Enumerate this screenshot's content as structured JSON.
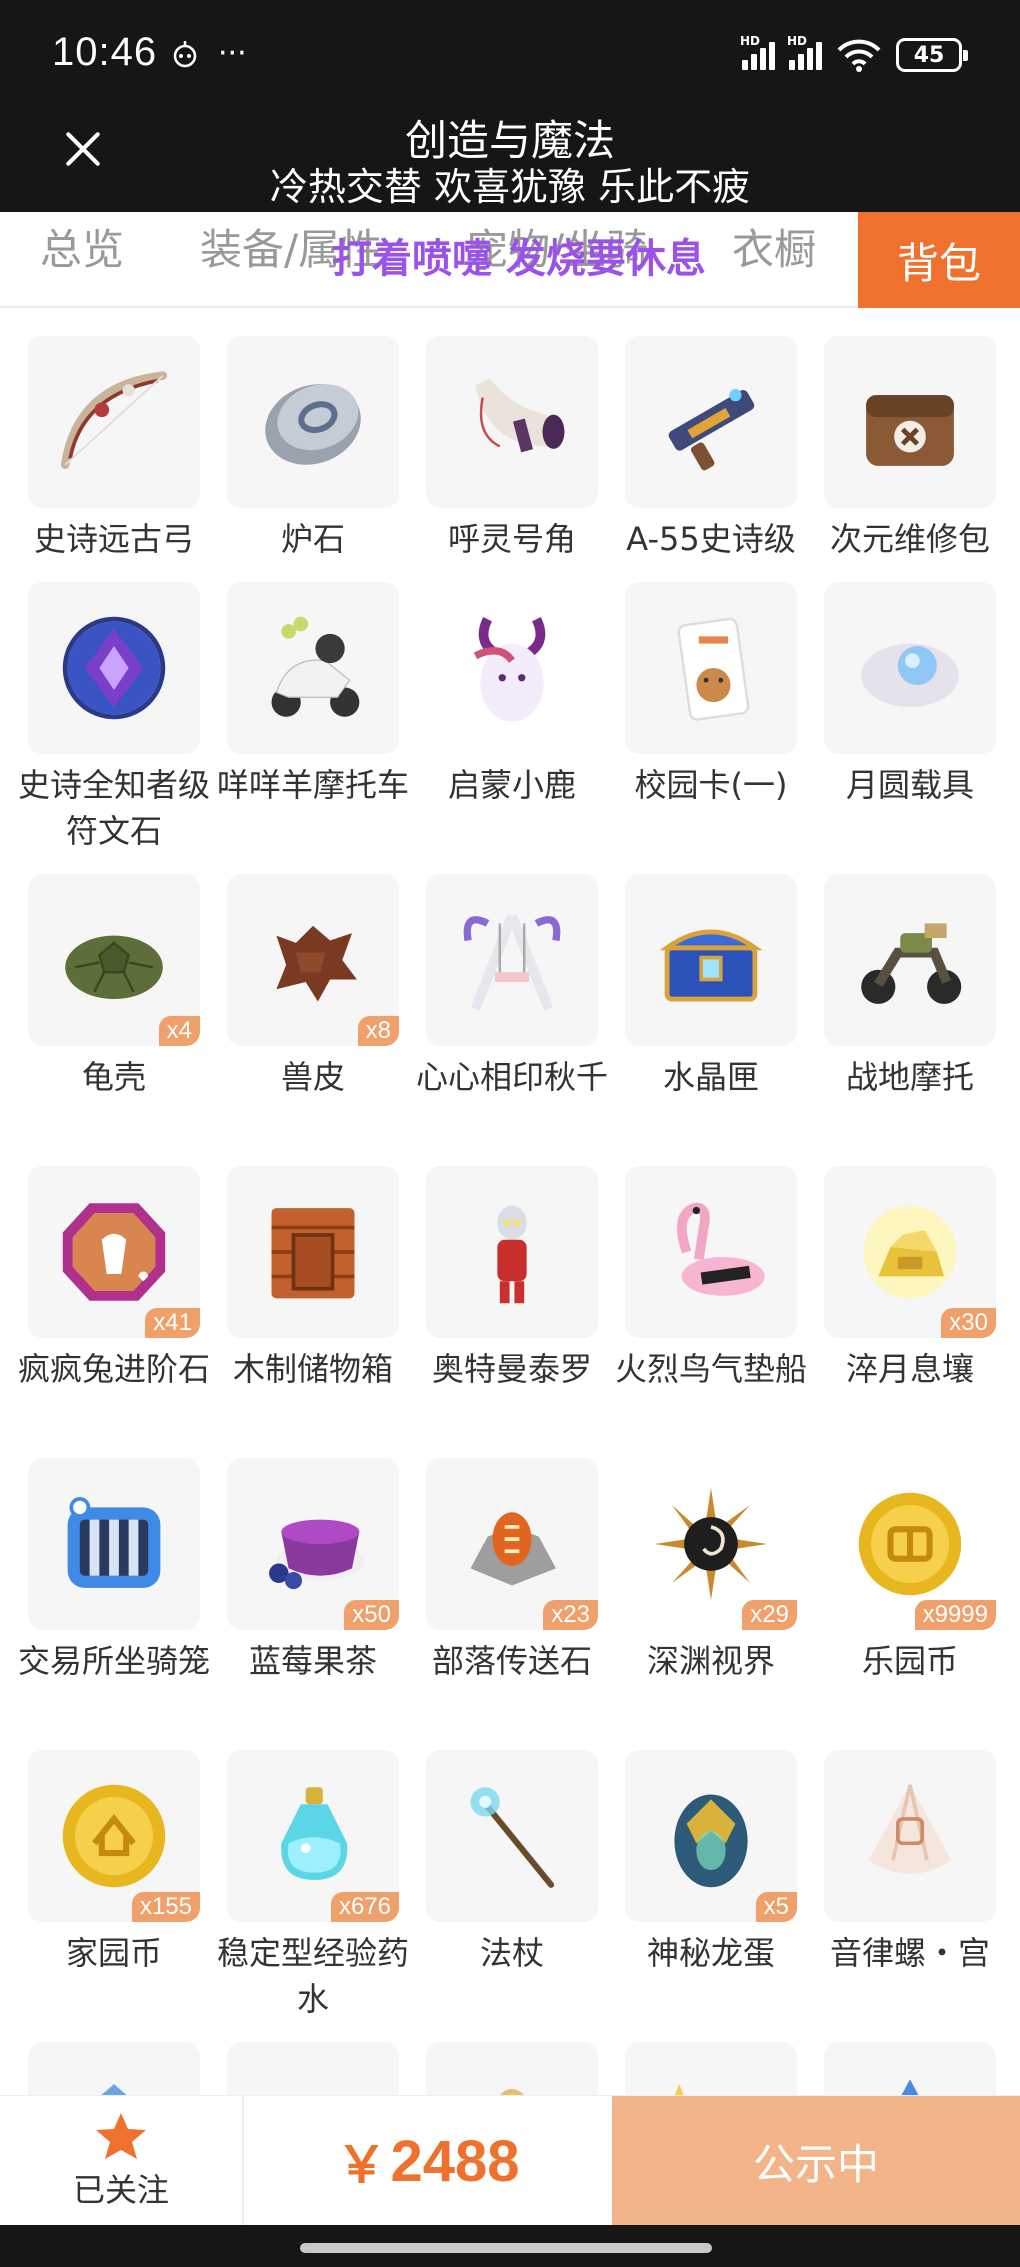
{
  "status_bar": {
    "time": "10:46",
    "more": "···",
    "battery": "45",
    "net1": "HD",
    "net2": "HD"
  },
  "header": {
    "title": "创造与魔法",
    "subtitle": "冷热交替 欢喜犹豫 乐此不疲"
  },
  "tabs": {
    "overview": "总览",
    "equipment": "装备/属性",
    "pets": "宠物/坐骑",
    "wardrobe": "衣橱",
    "bag": "背包",
    "overlay_text": "打着喷嚏 发烧要休息"
  },
  "items": [
    {
      "name": "史诗远古弓",
      "icon": "bow-icon",
      "badge": ""
    },
    {
      "name": "炉石",
      "icon": "hearthstone-icon",
      "badge": ""
    },
    {
      "name": "呼灵号角",
      "icon": "horn-icon",
      "badge": ""
    },
    {
      "name": "A-55史诗级",
      "icon": "gun-icon",
      "badge": ""
    },
    {
      "name": "次元维修包",
      "icon": "repair-bag-icon",
      "badge": ""
    },
    {
      "name": "史诗全知者级符文石",
      "icon": "rune-stone-icon",
      "badge": ""
    },
    {
      "name": "咩咩羊摩托车",
      "icon": "sheep-motorbike-icon",
      "badge": ""
    },
    {
      "name": "启蒙小鹿",
      "icon": "deer-icon",
      "badge": ""
    },
    {
      "name": "校园卡(一)",
      "icon": "campus-card-icon",
      "badge": ""
    },
    {
      "name": "月圆载具",
      "icon": "moon-vehicle-icon",
      "badge": ""
    },
    {
      "name": "龟壳",
      "icon": "turtle-shell-icon",
      "badge": "x4"
    },
    {
      "name": "兽皮",
      "icon": "animal-hide-icon",
      "badge": "x8"
    },
    {
      "name": "心心相印秋千",
      "icon": "swing-icon",
      "badge": ""
    },
    {
      "name": "水晶匣",
      "icon": "crystal-chest-icon",
      "badge": ""
    },
    {
      "name": "战地摩托",
      "icon": "battle-motorbike-icon",
      "badge": ""
    },
    {
      "name": "疯疯兔进阶石",
      "icon": "rabbit-stone-icon",
      "badge": "x41"
    },
    {
      "name": "木制储物箱",
      "icon": "wooden-box-icon",
      "badge": ""
    },
    {
      "name": "奥特曼泰罗",
      "icon": "ultraman-icon",
      "badge": ""
    },
    {
      "name": "火烈鸟气垫船",
      "icon": "flamingo-float-icon",
      "badge": ""
    },
    {
      "name": "淬月息壤",
      "icon": "gold-soil-icon",
      "badge": "x30"
    },
    {
      "name": "交易所坐骑笼",
      "icon": "mount-cage-icon",
      "badge": ""
    },
    {
      "name": "蓝莓果茶",
      "icon": "blueberry-tea-icon",
      "badge": "x50"
    },
    {
      "name": "部落传送石",
      "icon": "teleport-stone-icon",
      "badge": "x23"
    },
    {
      "name": "深渊视界",
      "icon": "abyss-eye-icon",
      "badge": "x29"
    },
    {
      "name": "乐园币",
      "icon": "park-coin-icon",
      "badge": "x9999"
    },
    {
      "name": "家园币",
      "icon": "home-coin-icon",
      "badge": "x155"
    },
    {
      "name": "稳定型经验药水",
      "icon": "exp-potion-icon",
      "badge": "x676"
    },
    {
      "name": "法杖",
      "icon": "staff-icon",
      "badge": ""
    },
    {
      "name": "神秘龙蛋",
      "icon": "dragon-egg-icon",
      "badge": "x5"
    },
    {
      "name": "音律螺・宫",
      "icon": "conch-icon",
      "badge": ""
    }
  ],
  "bottom": {
    "follow_label": "已关注",
    "price_symbol": "￥",
    "price_value": "2488",
    "action_label": "公示中"
  },
  "colors": {
    "accent": "#f0712d",
    "badge": "#f0a06a",
    "action_bg": "#f4b48a",
    "overlay_text": "#9a52e8",
    "header_bg": "#161616"
  }
}
